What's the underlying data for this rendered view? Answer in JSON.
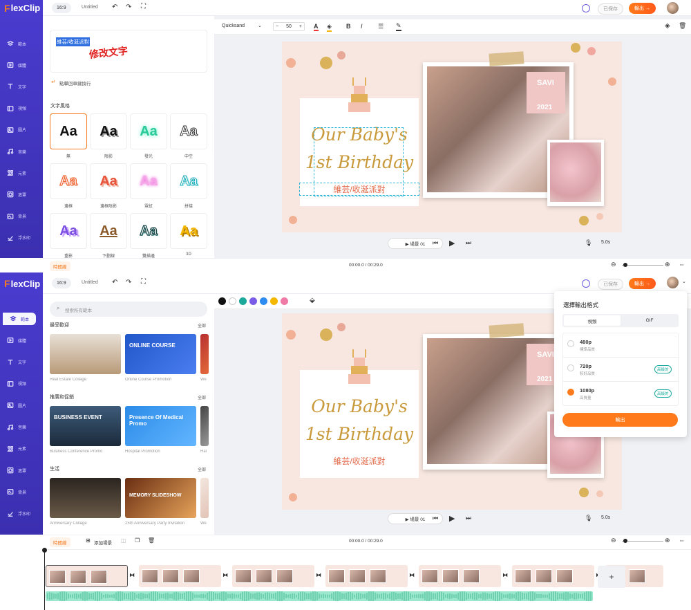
{
  "app": {
    "logo": "FlexClip",
    "logo_f": "F",
    "logo_rest": "lexClip"
  },
  "screen1": {
    "topbar": {
      "ratio": "16:9",
      "title": "Untitled",
      "saved": "已保存",
      "export": "輸出 →"
    },
    "sidebar": [
      "範本",
      "媒體",
      "文字",
      "視頻",
      "圖片",
      "音樂",
      "元素",
      "遮罩",
      "背景",
      "浮水印"
    ],
    "text_editor": {
      "selected_text": "維芸/收涎派對",
      "annotation": "修改文字",
      "newline_tip": "點擊回車鍵換行"
    },
    "text_style_title": "文字風格",
    "styles": [
      {
        "label": "無",
        "sample": "Aa"
      },
      {
        "label": "陰影",
        "sample": "Aa"
      },
      {
        "label": "發光",
        "sample": "Aa"
      },
      {
        "label": "中空",
        "sample": "Aa"
      },
      {
        "label": "邊框",
        "sample": "Aa"
      },
      {
        "label": "邊框陰影",
        "sample": "Aa"
      },
      {
        "label": "霓虹",
        "sample": "Aa"
      },
      {
        "label": "拼接",
        "sample": "Aa"
      },
      {
        "label": "重影",
        "sample": "Aa"
      },
      {
        "label": "下劃線",
        "sample": "Aa"
      },
      {
        "label": "雙描邊",
        "sample": "Aa"
      },
      {
        "label": "3D",
        "sample": "Aa"
      }
    ],
    "toolbar": {
      "font": "Quicksand",
      "size": "50",
      "minus": "−",
      "plus": "+",
      "bold": "B",
      "italic": "I"
    },
    "canvas": {
      "title1": "Our Baby's",
      "title2": "1st Birthday",
      "subtitle": "維芸/收涎派對",
      "sign": "SAVI",
      "year": "2021"
    },
    "play": {
      "scene": "▶ 場景 01",
      "duration": "5.0s"
    },
    "timeline": {
      "label": "時間線",
      "time": "00:00.0 / 00:29.0"
    }
  },
  "screen2": {
    "topbar": {
      "ratio": "16:9",
      "title": "Untitled",
      "saved": "已保存",
      "export": "輸出 →"
    },
    "sidebar": [
      "範本",
      "媒體",
      "文字",
      "視頻",
      "圖片",
      "音樂",
      "元素",
      "遮罩",
      "背景",
      "浮水印"
    ],
    "search_placeholder": "搜索所有範本",
    "sections": [
      {
        "title": "最受歡迎",
        "all": "全部",
        "items": [
          "Real Estate Collage",
          "Online Course Promotion",
          "We"
        ]
      },
      {
        "title": "推廣和促銷",
        "all": "全部",
        "items": [
          "Business Conference Promo",
          "Hospital Promotion",
          "Hal"
        ]
      },
      {
        "title": "生活",
        "all": "全部",
        "items": [
          "Anniversary Collage",
          "25th Anniversary Party Invitation",
          "We"
        ]
      }
    ],
    "thumb_texts": {
      "online_course": "ONLINE COURSE",
      "business_event": "BUSINESS EVENT",
      "presence": "Presence Of Medical Promo",
      "memory": "MEMORY SLIDESHOW"
    },
    "colors": [
      "#111111",
      "#ffffff",
      "#1aa99b",
      "#7b5ce6",
      "#2e8cf0",
      "#f5b800",
      "#f07aa6"
    ],
    "canvas": {
      "title1": "Our Baby's",
      "title2": "1st Birthday",
      "subtitle": "維芸/收涎派對",
      "sign": "SAVI",
      "year": "2021"
    },
    "play": {
      "scene": "▶ 場景 01",
      "duration": "5.0s"
    },
    "timeline": {
      "label": "時間線",
      "add_scene": "添加場景",
      "time": "00:00.0 / 00:29.0",
      "add": "+"
    },
    "export_popup": {
      "title": "選擇輸出格式",
      "tabs": [
        "視頻",
        "GIF"
      ],
      "options": [
        {
          "res": "480p",
          "desc": "標準品質",
          "badge": ""
        },
        {
          "res": "720p",
          "desc": "較好品質",
          "badge": "高級的"
        },
        {
          "res": "1080p",
          "desc": "高質量",
          "badge": "高級的"
        }
      ],
      "button": "輸出"
    }
  }
}
